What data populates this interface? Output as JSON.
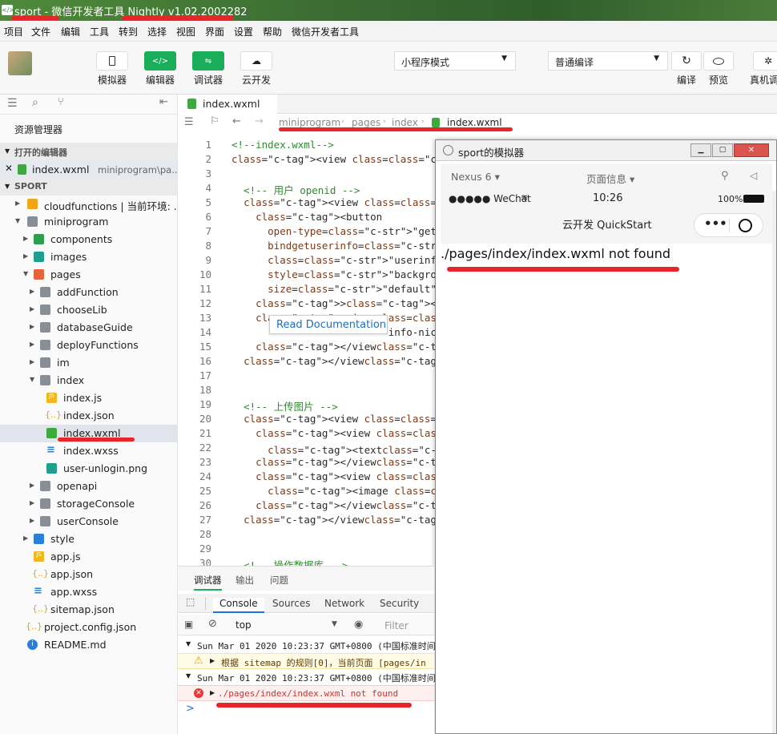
{
  "window": {
    "title": "sport - 微信开发者工具 Nightly v1.02.2002282"
  },
  "menu": [
    "项目",
    "文件",
    "编辑",
    "工具",
    "转到",
    "选择",
    "视图",
    "界面",
    "设置",
    "帮助",
    "微信开发者工具"
  ],
  "toolbar": {
    "simulator": "模拟器",
    "editor": "编辑器",
    "debugger": "调试器",
    "cloud": "云开发",
    "mode_select": "小程序模式",
    "compile_select": "普通编译",
    "compile": "编译",
    "preview": "预览",
    "realdebug": "真机调"
  },
  "sidebar": {
    "title": "资源管理器",
    "open_editors": "打开的编辑器",
    "open_file": "index.wxml",
    "open_file_path": "miniprogram\\pa...",
    "project": "SPORT",
    "items": [
      {
        "label": "cloudfunctions | 当前环境: ..."
      },
      {
        "label": "miniprogram"
      },
      {
        "label": "components"
      },
      {
        "label": "images"
      },
      {
        "label": "pages"
      },
      {
        "label": "addFunction"
      },
      {
        "label": "chooseLib"
      },
      {
        "label": "databaseGuide"
      },
      {
        "label": "deployFunctions"
      },
      {
        "label": "im"
      },
      {
        "label": "index"
      },
      {
        "label": "index.js"
      },
      {
        "label": "index.json"
      },
      {
        "label": "index.wxml"
      },
      {
        "label": "index.wxss"
      },
      {
        "label": "user-unlogin.png"
      },
      {
        "label": "openapi"
      },
      {
        "label": "storageConsole"
      },
      {
        "label": "userConsole"
      },
      {
        "label": "style"
      },
      {
        "label": "app.js"
      },
      {
        "label": "app.json"
      },
      {
        "label": "app.wxss"
      },
      {
        "label": "sitemap.json"
      },
      {
        "label": "project.config.json"
      },
      {
        "label": "README.md"
      }
    ]
  },
  "editor": {
    "tab": "index.wxml",
    "breadcrumb": [
      "miniprogram",
      "pages",
      "index",
      "index.wxml"
    ],
    "tooltip": "Read Documentation",
    "lines": [
      "<!--index.wxml-->",
      "<view class=\"container\">",
      "",
      "  <!-- 用户 openid -->",
      "  <view class=\"userinfo\">",
      "    <button",
      "      open-type=\"getUserInfo\"",
      "      bindgetuserinfo=\"onGetUserI",
      "      class=\"userinfo-avatar\"",
      "      style=\"background-image: ur",
      "      size=\"default\"",
      "    ></button>",
      "    <view class=\"userinfo-nicknam",
      "                          info-nic",
      "    </view>",
      "  </view>",
      "",
      "",
      "  <!-- 上传图片 -->",
      "  <view class=\"uploader\">",
      "    <view class=\"uploader-text\" b",
      "      <text>上传图片</text>",
      "    </view>",
      "    <view class=\"uploader-contain",
      "      <image class=\"uploader-imag",
      "    </view>",
      "  </view>",
      "",
      "",
      "  <!-- 操作数据库 -->"
    ]
  },
  "simulator": {
    "title": "sport的模拟器",
    "device": "Nexus 6",
    "page_info": "页面信息",
    "carrier": "●●●●● WeChat",
    "time": "10:26",
    "battery": "100%",
    "nav_title": "云开发 QuickStart",
    "error_text": "./pages/index/index.wxml not found"
  },
  "devtools": {
    "tabs": [
      "调试器",
      "输出",
      "问题"
    ],
    "panel_tabs": [
      "Console",
      "Sources",
      "Network",
      "Security"
    ],
    "context": "top",
    "filter_placeholder": "Filter",
    "logs": [
      {
        "time": "Sun Mar 01 2020 10:23:37 GMT+0800 (中国标准时间",
        "msg": "根据 sitemap 的规则[0]，当前页面 [pages/in",
        "level": "warning"
      },
      {
        "time": "Sun Mar 01 2020 10:23:37 GMT+0800 (中国标准时间",
        "msg": "./pages/index/index.wxml not found",
        "level": "error"
      }
    ],
    "prompt": ">"
  }
}
